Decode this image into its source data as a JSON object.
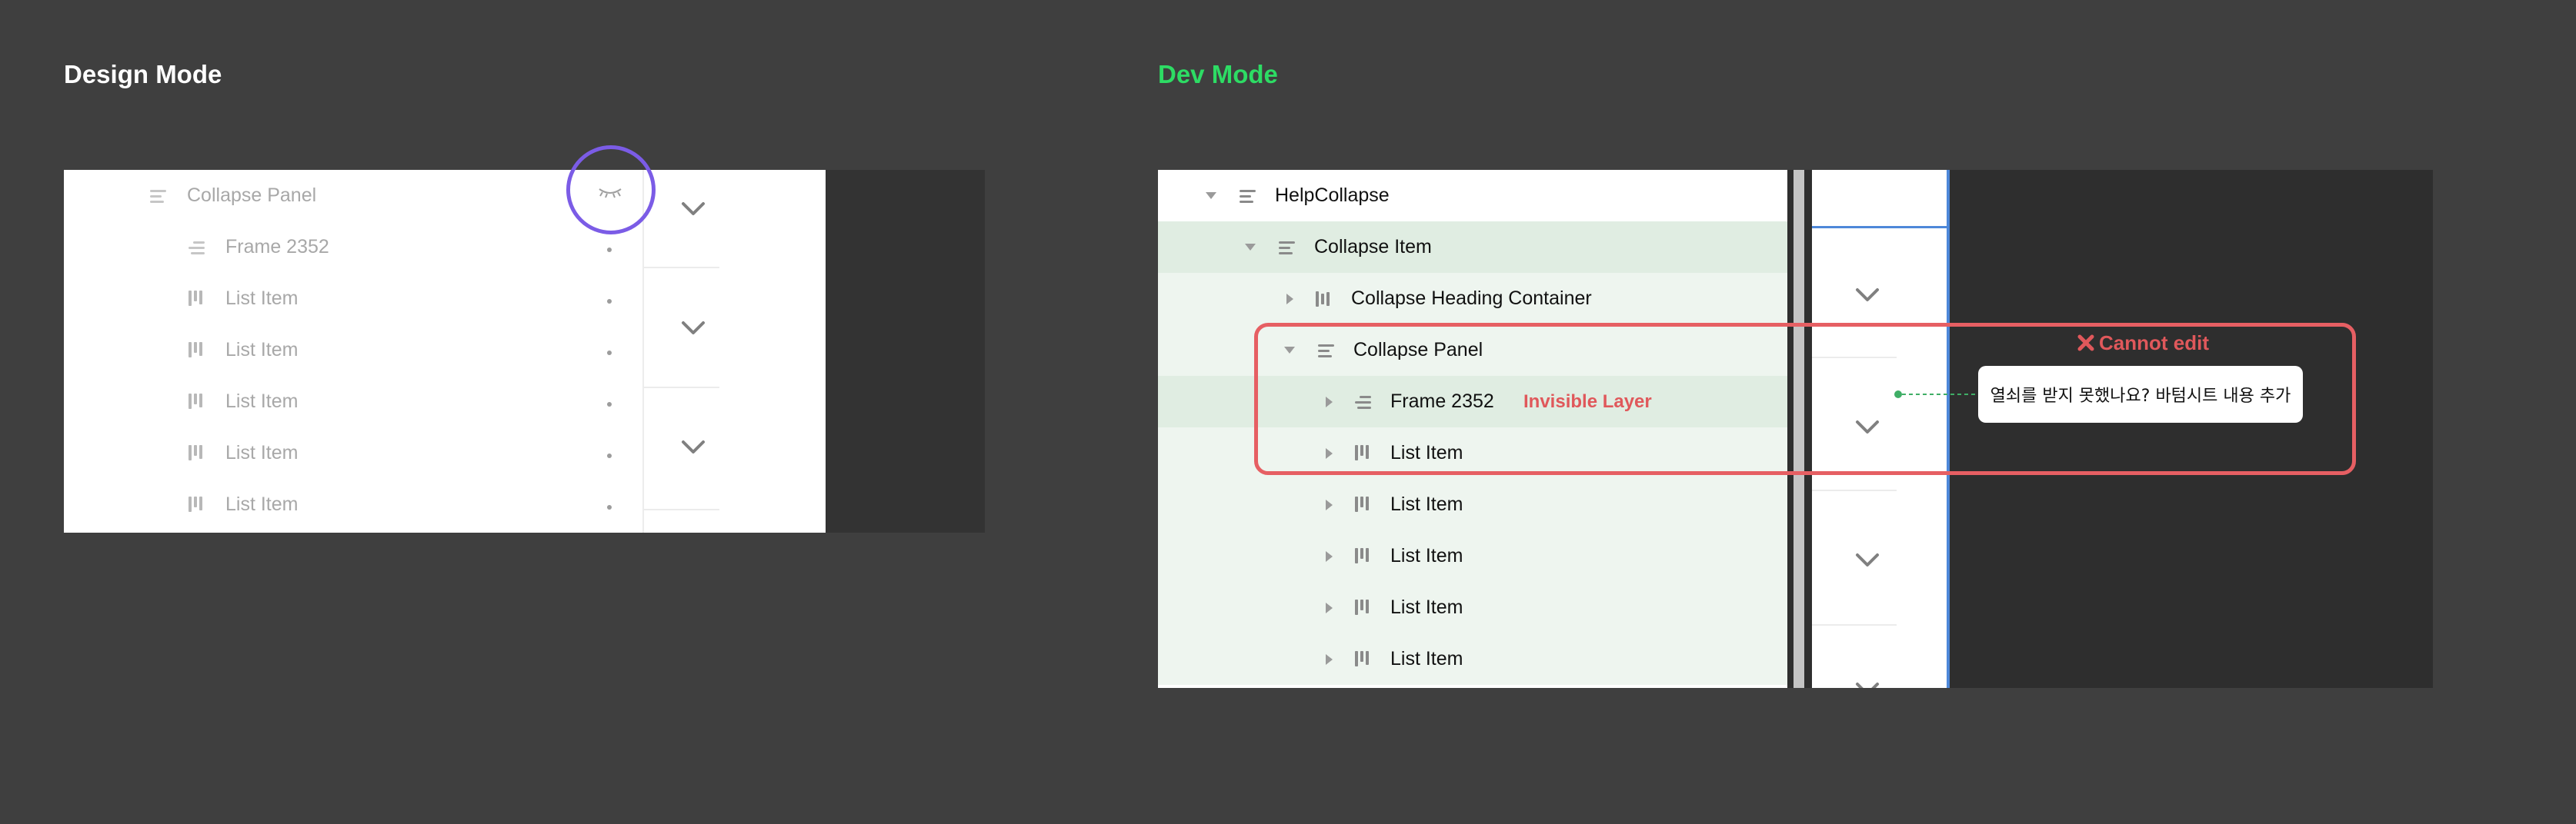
{
  "design_mode": {
    "title": "Design Mode",
    "title_color": "#ffffff",
    "layers": [
      {
        "label": "Collapse Panel",
        "icon": "auto-layout-vertical-icon",
        "level": 0
      },
      {
        "label": "Frame 2352",
        "icon": "auto-layout-vertical-icon",
        "level": 1
      },
      {
        "label": "List Item",
        "icon": "auto-layout-horizontal-icon",
        "level": 1
      },
      {
        "label": "List Item",
        "icon": "auto-layout-horizontal-icon",
        "level": 1
      },
      {
        "label": "List Item",
        "icon": "auto-layout-horizontal-icon",
        "level": 1
      },
      {
        "label": "List Item",
        "icon": "auto-layout-horizontal-icon",
        "level": 1
      },
      {
        "label": "List Item",
        "icon": "auto-layout-horizontal-icon",
        "level": 1
      }
    ],
    "hidden_layer_icon": "eye-closed-icon",
    "highlight_color": "#7b5ce6"
  },
  "dev_mode": {
    "title": "Dev Mode",
    "title_color": "#2ddc64",
    "layers": [
      {
        "label": "HelpCollapse",
        "icon": "auto-layout-vertical-icon",
        "level": 0,
        "expanded": true,
        "highlight": "none"
      },
      {
        "label": "Collapse Item",
        "icon": "auto-layout-vertical-icon",
        "level": 1,
        "expanded": true,
        "highlight": "strong"
      },
      {
        "label": "Collapse Heading Container",
        "icon": "auto-layout-horizontal-icon",
        "level": 2,
        "expanded": false,
        "highlight": "light"
      },
      {
        "label": "Collapse Panel",
        "icon": "auto-layout-vertical-icon",
        "level": 2,
        "expanded": true,
        "highlight": "light"
      },
      {
        "label": "Frame 2352",
        "icon": "auto-layout-vertical-icon",
        "level": 3,
        "expanded": false,
        "highlight": "strong"
      },
      {
        "label": "List Item",
        "icon": "auto-layout-horizontal-icon",
        "level": 3,
        "expanded": false,
        "highlight": "light"
      },
      {
        "label": "List Item",
        "icon": "auto-layout-horizontal-icon",
        "level": 3,
        "expanded": false,
        "highlight": "light"
      },
      {
        "label": "List Item",
        "icon": "auto-layout-horizontal-icon",
        "level": 3,
        "expanded": false,
        "highlight": "light"
      },
      {
        "label": "List Item",
        "icon": "auto-layout-horizontal-icon",
        "level": 3,
        "expanded": false,
        "highlight": "light"
      },
      {
        "label": "List Item",
        "icon": "auto-layout-horizontal-icon",
        "level": 3,
        "expanded": false,
        "highlight": "light"
      }
    ],
    "invisible_layer_label": "Invisible Layer",
    "cannot_edit_label": "Cannot edit",
    "cannot_edit_icon": "x-mark-icon",
    "tooltip_text": "열쇠를 받지 못했나요? 바텀시트 내용 추가",
    "alert_color": "#e65f63",
    "highlight_strong": "#e0ede2",
    "highlight_light": "#eef5ef",
    "selection_color": "#4e88d9"
  }
}
